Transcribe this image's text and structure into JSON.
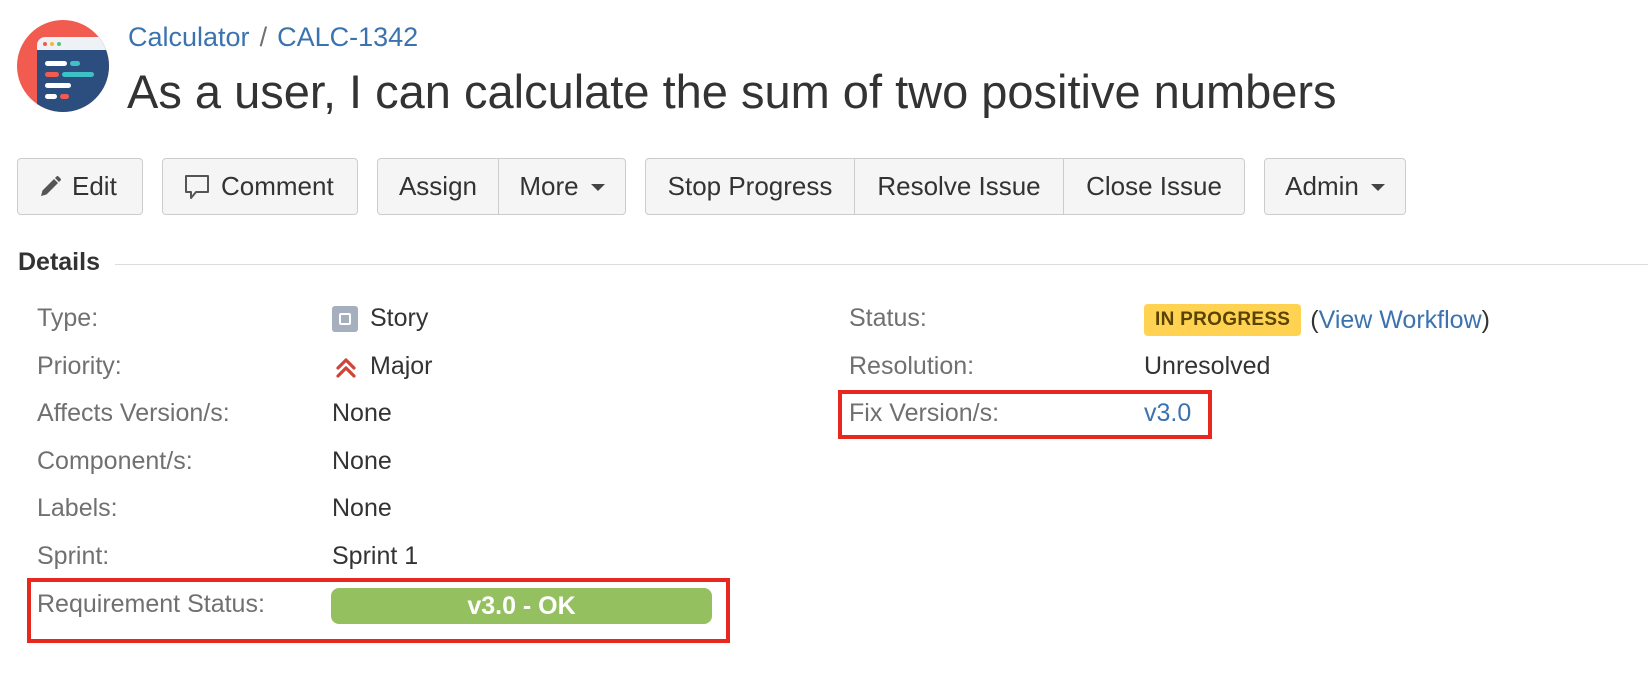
{
  "breadcrumbs": {
    "project": "Calculator",
    "separator": "/",
    "issue_key": "CALC-1342"
  },
  "issue": {
    "title": "As a user, I can calculate the sum of two positive numbers"
  },
  "toolbar": {
    "edit": "Edit",
    "comment": "Comment",
    "assign": "Assign",
    "more": "More",
    "stop_progress": "Stop Progress",
    "resolve_issue": "Resolve Issue",
    "close_issue": "Close Issue",
    "admin": "Admin"
  },
  "details": {
    "heading": "Details",
    "left": {
      "type": {
        "label": "Type:",
        "value": "Story",
        "icon": "story-icon"
      },
      "priority": {
        "label": "Priority:",
        "value": "Major",
        "icon": "priority-major-icon"
      },
      "affects_versions": {
        "label": "Affects Version/s:",
        "value": "None"
      },
      "components": {
        "label": "Component/s:",
        "value": "None"
      },
      "labels": {
        "label": "Labels:",
        "value": "None"
      },
      "sprint": {
        "label": "Sprint:",
        "value": "Sprint 1"
      },
      "requirement_status": {
        "label": "Requirement Status:",
        "value": "v3.0 - OK"
      }
    },
    "right": {
      "status": {
        "label": "Status:",
        "value": "IN PROGRESS",
        "open_paren": "(",
        "workflow_link": "View Workflow",
        "close_paren": ")"
      },
      "resolution": {
        "label": "Resolution:",
        "value": "Unresolved"
      },
      "fix_versions": {
        "label": "Fix Version/s:",
        "value": "v3.0"
      }
    }
  },
  "colors": {
    "link": "#3b73af",
    "status_lozenge": "#ffd351",
    "requirement_ok": "#95c05f",
    "highlight_box": "#e8281e",
    "project_avatar": "#f15b50"
  }
}
